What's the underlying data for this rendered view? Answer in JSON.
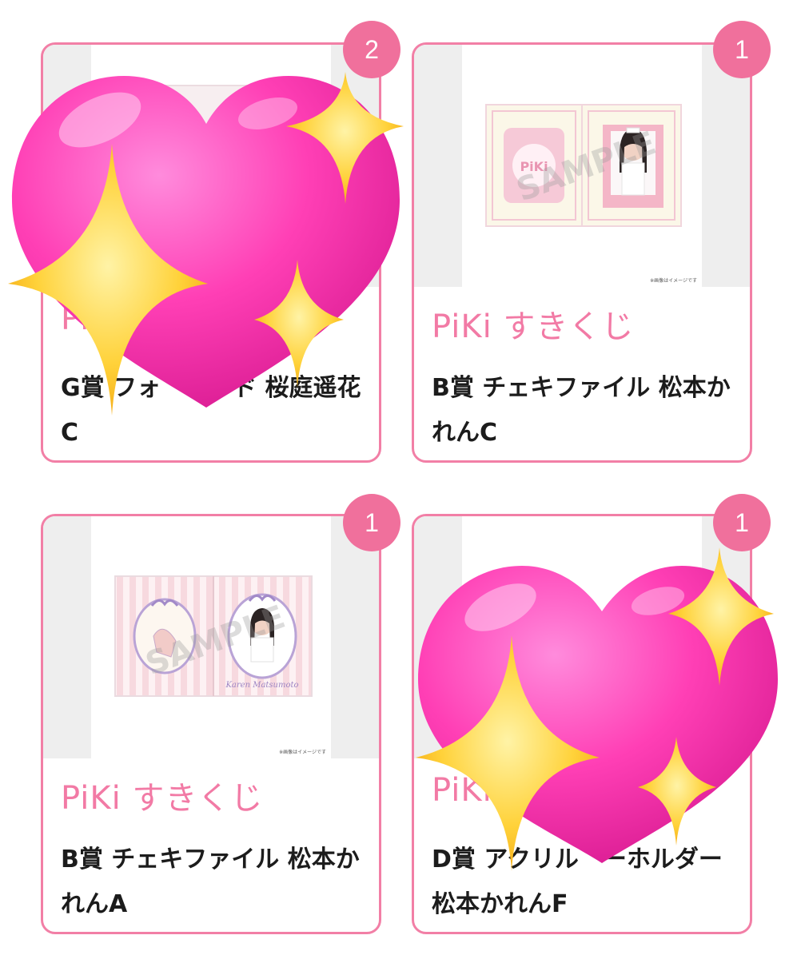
{
  "colors": {
    "accent": "#f27aa5",
    "border": "#f27fa6",
    "badge": "#f0709c",
    "heart": "#ff3fb5",
    "sparkle": "#ffd23a"
  },
  "cards": [
    {
      "badge": "2",
      "brand": "Pi",
      "title": "G賞 フォ　　ード 桜庭遥花C",
      "image_note": "",
      "covered_by": "sparkling-heart-emoji"
    },
    {
      "badge": "1",
      "brand": "PiKi すきくじ",
      "title": "B賞 チェキファイル 松本かれんC",
      "image_note": "※画像はイメージです",
      "watermark": "SAMPLE",
      "product_logo": "PiKi"
    },
    {
      "badge": "1",
      "brand": "PiKi すきくじ",
      "title": "B賞 チェキファイル 松本かれんA",
      "image_note": "※画像はイメージです",
      "watermark": "SAMPLE",
      "product_signature": "Karen Matsumoto"
    },
    {
      "badge": "1",
      "brand": "PiKi",
      "title": "D賞 アクリル　ーホルダー 松本かれんF",
      "image_note": "",
      "covered_by": "sparkling-heart-emoji"
    }
  ]
}
